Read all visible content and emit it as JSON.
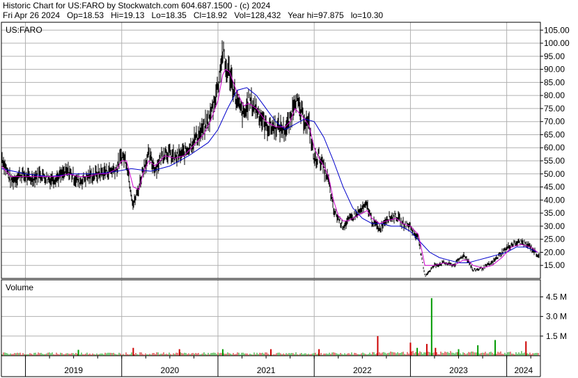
{
  "header": {
    "line1": "Historic Chart for US:FARO by Stockwatch.com 604.687.1500 - (c) 2024",
    "line2": "Fri Apr 26 2024   Op=18.53   Hi=19.13   Lo=18.35   Cl=18.92   Vol=128,432   Year hi=97.875   lo=10.30"
  },
  "chart_data": [
    {
      "type": "line",
      "title": "US:FARO",
      "ylim": [
        10,
        108
      ],
      "ytick_labels": [
        "105.00",
        "100.00",
        "95.00",
        "90.00",
        "85.00",
        "80.00",
        "75.00",
        "70.00",
        "65.00",
        "60.00",
        "55.00",
        "50.00",
        "45.00",
        "40.00",
        "35.00",
        "30.00",
        "25.00",
        "20.00",
        "15.00"
      ],
      "ytick_values": [
        105,
        100,
        95,
        90,
        85,
        80,
        75,
        70,
        65,
        60,
        55,
        50,
        45,
        40,
        35,
        30,
        25,
        20,
        15
      ],
      "grid": true,
      "colors": {
        "price": "#000000",
        "ma_short": "#cc00cc",
        "ma_long": "#0000cc",
        "grid": "#b0b0b0"
      },
      "price_series": {
        "x": [
          2018.75,
          2018.85,
          2018.95,
          2019.05,
          2019.15,
          2019.25,
          2019.35,
          2019.45,
          2019.55,
          2019.65,
          2019.75,
          2019.85,
          2019.95,
          2020.0,
          2020.05,
          2020.12,
          2020.18,
          2020.22,
          2020.28,
          2020.35,
          2020.45,
          2020.55,
          2020.65,
          2020.75,
          2020.85,
          2020.92,
          2021.0,
          2021.05,
          2021.08,
          2021.12,
          2021.2,
          2021.27,
          2021.32,
          2021.4,
          2021.5,
          2021.6,
          2021.7,
          2021.75,
          2021.8,
          2021.85,
          2021.9,
          2021.95,
          2022.0,
          2022.05,
          2022.1,
          2022.15,
          2022.2,
          2022.25,
          2022.3,
          2022.35,
          2022.45,
          2022.55,
          2022.6,
          2022.68,
          2022.75,
          2022.85,
          2022.92,
          2023.0,
          2023.05,
          2023.08,
          2023.1,
          2023.15,
          2023.25,
          2023.35,
          2023.45,
          2023.55,
          2023.6,
          2023.65,
          2023.75,
          2023.85,
          2023.95,
          2024.05,
          2024.15,
          2024.25,
          2024.32
        ],
        "y": [
          57,
          47,
          50,
          48,
          50,
          48,
          49,
          51,
          47,
          49,
          50,
          51,
          52,
          57,
          55,
          38,
          45,
          52,
          57,
          52,
          59,
          56,
          58,
          63,
          67,
          72,
          84,
          97,
          90,
          89,
          77,
          72,
          78,
          75,
          68,
          68,
          67,
          70,
          80,
          74,
          71,
          68,
          55,
          57,
          52,
          47,
          36,
          33,
          30,
          32,
          35,
          38,
          32,
          29,
          33,
          34,
          31,
          30,
          26,
          27,
          21,
          11,
          15,
          16,
          15,
          19,
          17,
          13,
          14,
          16,
          20,
          23,
          24,
          22,
          19
        ]
      },
      "ma_short": {
        "x": [
          2018.75,
          2018.85,
          2018.95,
          2019.05,
          2019.15,
          2019.25,
          2019.35,
          2019.45,
          2019.55,
          2019.65,
          2019.75,
          2019.85,
          2019.95,
          2020.0,
          2020.05,
          2020.12,
          2020.18,
          2020.22,
          2020.28,
          2020.35,
          2020.45,
          2020.55,
          2020.65,
          2020.75,
          2020.85,
          2020.92,
          2021.0,
          2021.05,
          2021.08,
          2021.12,
          2021.2,
          2021.27,
          2021.32,
          2021.4,
          2021.5,
          2021.6,
          2021.7,
          2021.75,
          2021.8,
          2021.85,
          2021.9,
          2021.95,
          2022.0,
          2022.05,
          2022.1,
          2022.15,
          2022.2,
          2022.25,
          2022.3,
          2022.35,
          2022.45,
          2022.55,
          2022.6,
          2022.68,
          2022.75,
          2022.85,
          2022.92,
          2023.0,
          2023.05,
          2023.08,
          2023.1,
          2023.15,
          2023.25,
          2023.35,
          2023.45,
          2023.55,
          2023.6,
          2023.65,
          2023.75,
          2023.85,
          2023.95,
          2024.05,
          2024.15,
          2024.25,
          2024.32
        ],
        "y": [
          53,
          49,
          49,
          49,
          49,
          49,
          49,
          50,
          49,
          49,
          50,
          50,
          52,
          55,
          55,
          45,
          44,
          50,
          55,
          53,
          57,
          56,
          57,
          61,
          65,
          70,
          78,
          88,
          90,
          89,
          81,
          76,
          77,
          75,
          70,
          68,
          68,
          70,
          75,
          73,
          71,
          68,
          60,
          56,
          53,
          49,
          40,
          34,
          32,
          32,
          34,
          36,
          33,
          31,
          32,
          33,
          31,
          30,
          28,
          27,
          24,
          15,
          15,
          16,
          15,
          17,
          17,
          15,
          14,
          15,
          18,
          22,
          23,
          22,
          20
        ]
      },
      "ma_long": {
        "x": [
          2018.75,
          2019.0,
          2019.25,
          2019.5,
          2019.75,
          2019.95,
          2020.1,
          2020.3,
          2020.5,
          2020.7,
          2020.9,
          2021.0,
          2021.1,
          2021.2,
          2021.3,
          2021.4,
          2021.5,
          2021.6,
          2021.7,
          2021.8,
          2021.9,
          2022.0,
          2022.1,
          2022.2,
          2022.3,
          2022.4,
          2022.5,
          2022.6,
          2022.7,
          2022.8,
          2022.9,
          2023.0,
          2023.1,
          2023.2,
          2023.3,
          2023.4,
          2023.5,
          2023.6,
          2023.7,
          2023.8,
          2023.9,
          2024.0,
          2024.1,
          2024.2,
          2024.32
        ],
        "y": [
          52,
          50,
          49,
          50,
          50,
          51,
          52,
          51,
          53,
          57,
          62,
          67,
          75,
          82,
          83,
          80,
          75,
          70,
          67,
          69,
          71,
          70,
          64,
          55,
          45,
          37,
          33,
          31,
          31,
          30,
          30,
          28,
          24,
          20,
          18,
          17,
          16,
          16,
          17,
          18,
          19,
          20,
          22,
          22,
          20
        ]
      }
    },
    {
      "type": "bar",
      "title": "Volume",
      "ylim": [
        0,
        5.8
      ],
      "ytick_labels": [
        "4.5 M",
        "3.0 M",
        "1.5 M"
      ],
      "ytick_values": [
        4.5,
        3.0,
        1.5
      ],
      "grid": true,
      "up_color": "#009900",
      "down_color": "#cc0000",
      "spikes": [
        {
          "x": 2022.66,
          "v": 1.5,
          "dir": "down"
        },
        {
          "x": 2023.0,
          "v": 1.0,
          "dir": "down"
        },
        {
          "x": 2023.07,
          "v": 0.6,
          "dir": "up"
        },
        {
          "x": 2023.17,
          "v": 0.9,
          "dir": "down"
        },
        {
          "x": 2023.22,
          "v": 4.4,
          "dir": "up"
        },
        {
          "x": 2023.26,
          "v": 0.6,
          "dir": "down"
        },
        {
          "x": 2023.5,
          "v": 0.5,
          "dir": "up"
        },
        {
          "x": 2023.7,
          "v": 0.8,
          "dir": "up"
        },
        {
          "x": 2023.88,
          "v": 1.2,
          "dir": "up"
        },
        {
          "x": 2024.2,
          "v": 1.1,
          "dir": "down"
        },
        {
          "x": 2022.05,
          "v": 0.5,
          "dir": "down"
        },
        {
          "x": 2020.12,
          "v": 0.6,
          "dir": "down"
        },
        {
          "x": 2021.05,
          "v": 0.5,
          "dir": "up"
        },
        {
          "x": 2019.55,
          "v": 0.45,
          "dir": "up"
        },
        {
          "x": 2020.6,
          "v": 0.5,
          "dir": "down"
        },
        {
          "x": 2021.55,
          "v": 0.5,
          "dir": "down"
        }
      ]
    }
  ],
  "xaxis": {
    "labels": [
      "2019",
      "2020",
      "2021",
      "2022",
      "2023",
      "2024"
    ],
    "label_years": [
      2019,
      2020,
      2021,
      2022,
      2023,
      2024
    ],
    "xlim": [
      2018.75,
      2024.35
    ]
  }
}
